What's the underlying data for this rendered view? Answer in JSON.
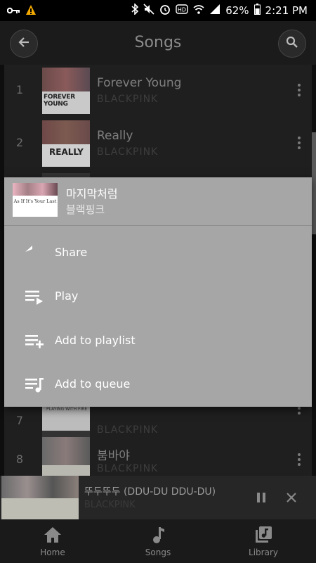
{
  "status_bar": {
    "battery": "62%",
    "time": "2:21 PM"
  },
  "app_bar": {
    "title": "Songs"
  },
  "songs": [
    {
      "number": "1",
      "title": "Forever Young",
      "artist": "BLACKPINK",
      "thumb_text": "FOREVER YOUNG"
    },
    {
      "number": "2",
      "title": "Really",
      "artist": "BLACKPINK",
      "thumb_text": "REALLY"
    },
    {
      "number": "7",
      "title": "",
      "artist": "BLACKPINK",
      "thumb_text": "PLAYING WITH FIRE"
    },
    {
      "number": "8",
      "title": "붐바야",
      "artist": "BLACKPINK",
      "thumb_text": ""
    }
  ],
  "context_menu": {
    "song_title": "마지막처럼",
    "song_artist": "블랙핑크",
    "thumb_text": "As If It's Your Last",
    "items": [
      {
        "label": "Share",
        "icon": "share-icon"
      },
      {
        "label": "Play",
        "icon": "play-icon"
      },
      {
        "label": "Add to playlist",
        "icon": "add-to-playlist-icon"
      },
      {
        "label": "Add to queue",
        "icon": "add-to-queue-icon"
      }
    ]
  },
  "mini_player": {
    "title": "뚜두뚜두 (DDU-DU DDU-DU)",
    "artist": "BLACKPINK"
  },
  "bottom_nav": [
    {
      "label": "Home",
      "icon": "home-icon"
    },
    {
      "label": "Songs",
      "icon": "music-note-icon"
    },
    {
      "label": "Library",
      "icon": "library-icon"
    }
  ],
  "colors": {
    "background": "#0e0e0e",
    "sheet": "#a6a6a6",
    "status_warning": "#f2a900"
  }
}
